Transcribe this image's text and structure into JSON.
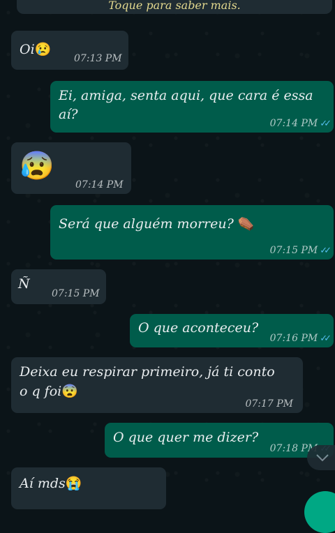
{
  "notice": {
    "text": "Toque para saber mais."
  },
  "messages": [
    {
      "text": "Oi",
      "emoji": "😢",
      "time": "07:13 PM"
    },
    {
      "line1": "Ei, amiga, senta aqui, que cara é essa",
      "line2": "aí?",
      "time": "07:14 PM",
      "ticks": "✓✓"
    },
    {
      "emoji": "😰",
      "time": "07:14 PM"
    },
    {
      "text": "Será que alguém morreu?",
      "emoji": "⚰️",
      "time": "07:15 PM",
      "ticks": "✓✓"
    },
    {
      "text": "Ñ",
      "time": "07:15 PM"
    },
    {
      "text": "O que aconteceu?",
      "time": "07:16 PM",
      "ticks": "✓✓"
    },
    {
      "line1": "Deixa eu respirar primeiro, já ti conto",
      "line2": "o q foi",
      "emoji": "😨",
      "time": "07:17 PM"
    },
    {
      "text": "O que quer me dizer?",
      "time": "07:18 PM",
      "ticks": "✓✓"
    },
    {
      "text": "Aí mds",
      "emoji": "😭"
    }
  ],
  "colors": {
    "incoming": "#1f2c33",
    "outgoing": "#005c4b",
    "read_ticks": "#53bdeb",
    "background": "#0b1418"
  },
  "icons": {
    "scroll_down": "chevron-down-icon"
  }
}
